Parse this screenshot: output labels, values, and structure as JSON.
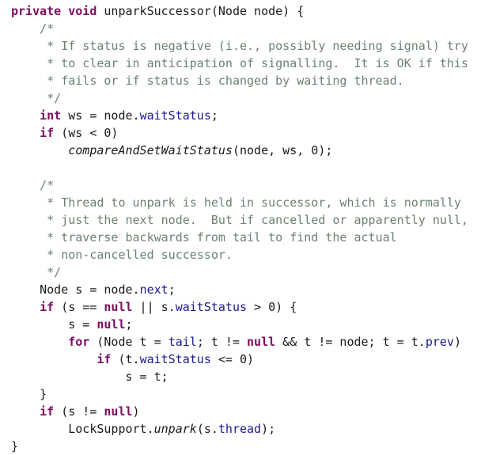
{
  "editor": {
    "language": "java",
    "background_color": "#ffffff",
    "font_size_px": 15,
    "line_height_px": 22,
    "colors": {
      "keyword": "#7a0e5e",
      "comment": "#6b8270",
      "field": "#1a1a8c",
      "method": "#1a1a1a",
      "plain": "#1a1a1a"
    }
  },
  "code": {
    "lines": [
      {
        "index": 1,
        "text": "private void unparkSuccessor(Node node) {",
        "tokens": [
          {
            "t": "private",
            "k": "kw"
          },
          {
            "t": " ",
            "k": "pln"
          },
          {
            "t": "void",
            "k": "kw"
          },
          {
            "t": " unparkSuccessor(Node node) {",
            "k": "pln"
          }
        ]
      },
      {
        "index": 2,
        "text": "    /*",
        "tokens": [
          {
            "t": "    ",
            "k": "pln"
          },
          {
            "t": "/*",
            "k": "cmt"
          }
        ]
      },
      {
        "index": 3,
        "text": "     * If status is negative (i.e., possibly needing signal) try",
        "tokens": [
          {
            "t": "     ",
            "k": "pln"
          },
          {
            "t": "* If status is negative (i.e., possibly needing signal) try",
            "k": "cmt"
          }
        ]
      },
      {
        "index": 4,
        "text": "     * to clear in anticipation of signalling.  It is OK if this",
        "tokens": [
          {
            "t": "     ",
            "k": "pln"
          },
          {
            "t": "* to clear in anticipation of signalling.  It is OK if this",
            "k": "cmt"
          }
        ]
      },
      {
        "index": 5,
        "text": "     * fails or if status is changed by waiting thread.",
        "tokens": [
          {
            "t": "     ",
            "k": "pln"
          },
          {
            "t": "* fails or if status is changed by waiting thread.",
            "k": "cmt"
          }
        ]
      },
      {
        "index": 6,
        "text": "     */",
        "tokens": [
          {
            "t": "     ",
            "k": "pln"
          },
          {
            "t": "*/",
            "k": "cmt"
          }
        ]
      },
      {
        "index": 7,
        "text": "    int ws = node.waitStatus;",
        "tokens": [
          {
            "t": "    ",
            "k": "pln"
          },
          {
            "t": "int",
            "k": "kw"
          },
          {
            "t": " ws = node.",
            "k": "pln"
          },
          {
            "t": "waitStatus",
            "k": "fld"
          },
          {
            "t": ";",
            "k": "pln"
          }
        ]
      },
      {
        "index": 8,
        "text": "    if (ws < 0)",
        "tokens": [
          {
            "t": "    ",
            "k": "pln"
          },
          {
            "t": "if",
            "k": "kw"
          },
          {
            "t": " (ws < 0)",
            "k": "pln"
          }
        ]
      },
      {
        "index": 9,
        "text": "        compareAndSetWaitStatus(node, ws, 0);",
        "tokens": [
          {
            "t": "        ",
            "k": "pln"
          },
          {
            "t": "compareAndSetWaitStatus",
            "k": "mth"
          },
          {
            "t": "(node, ws, 0);",
            "k": "pln"
          }
        ]
      },
      {
        "index": 10,
        "text": "",
        "tokens": []
      },
      {
        "index": 11,
        "text": "    /*",
        "tokens": [
          {
            "t": "    ",
            "k": "pln"
          },
          {
            "t": "/*",
            "k": "cmt"
          }
        ]
      },
      {
        "index": 12,
        "text": "     * Thread to unpark is held in successor, which is normally",
        "tokens": [
          {
            "t": "     ",
            "k": "pln"
          },
          {
            "t": "* Thread to unpark is held in successor, which is normally",
            "k": "cmt"
          }
        ]
      },
      {
        "index": 13,
        "text": "     * just the next node.  But if cancelled or apparently null,",
        "tokens": [
          {
            "t": "     ",
            "k": "pln"
          },
          {
            "t": "* just the next node.  But if cancelled or apparently null,",
            "k": "cmt"
          }
        ]
      },
      {
        "index": 14,
        "text": "     * traverse backwards from tail to find the actual",
        "tokens": [
          {
            "t": "     ",
            "k": "pln"
          },
          {
            "t": "* traverse backwards from tail to find the actual",
            "k": "cmt"
          }
        ]
      },
      {
        "index": 15,
        "text": "     * non-cancelled successor.",
        "tokens": [
          {
            "t": "     ",
            "k": "pln"
          },
          {
            "t": "* non-cancelled successor.",
            "k": "cmt"
          }
        ]
      },
      {
        "index": 16,
        "text": "     */",
        "tokens": [
          {
            "t": "     ",
            "k": "pln"
          },
          {
            "t": "*/",
            "k": "cmt"
          }
        ]
      },
      {
        "index": 17,
        "text": "    Node s = node.next;",
        "tokens": [
          {
            "t": "    Node s = node.",
            "k": "pln"
          },
          {
            "t": "next",
            "k": "fld"
          },
          {
            "t": ";",
            "k": "pln"
          }
        ]
      },
      {
        "index": 18,
        "text": "    if (s == null || s.waitStatus > 0) {",
        "tokens": [
          {
            "t": "    ",
            "k": "pln"
          },
          {
            "t": "if",
            "k": "kw"
          },
          {
            "t": " (s == ",
            "k": "pln"
          },
          {
            "t": "null",
            "k": "kw"
          },
          {
            "t": " || s.",
            "k": "pln"
          },
          {
            "t": "waitStatus",
            "k": "fld"
          },
          {
            "t": " > 0) {",
            "k": "pln"
          }
        ]
      },
      {
        "index": 19,
        "text": "        s = null;",
        "tokens": [
          {
            "t": "        s = ",
            "k": "pln"
          },
          {
            "t": "null",
            "k": "kw"
          },
          {
            "t": ";",
            "k": "pln"
          }
        ]
      },
      {
        "index": 20,
        "text": "        for (Node t = tail; t != null && t != node; t = t.prev)",
        "tokens": [
          {
            "t": "        ",
            "k": "pln"
          },
          {
            "t": "for",
            "k": "kw"
          },
          {
            "t": " (Node t = ",
            "k": "pln"
          },
          {
            "t": "tail",
            "k": "fld"
          },
          {
            "t": "; t != ",
            "k": "pln"
          },
          {
            "t": "null",
            "k": "kw"
          },
          {
            "t": " && t != node; t = t.",
            "k": "pln"
          },
          {
            "t": "prev",
            "k": "fld"
          },
          {
            "t": ")",
            "k": "pln"
          }
        ]
      },
      {
        "index": 21,
        "text": "            if (t.waitStatus <= 0)",
        "tokens": [
          {
            "t": "            ",
            "k": "pln"
          },
          {
            "t": "if",
            "k": "kw"
          },
          {
            "t": " (t.",
            "k": "pln"
          },
          {
            "t": "waitStatus",
            "k": "fld"
          },
          {
            "t": " <= 0)",
            "k": "pln"
          }
        ]
      },
      {
        "index": 22,
        "text": "                s = t;",
        "tokens": [
          {
            "t": "                s = t;",
            "k": "pln"
          }
        ]
      },
      {
        "index": 23,
        "text": "    }",
        "tokens": [
          {
            "t": "    }",
            "k": "pln"
          }
        ]
      },
      {
        "index": 24,
        "text": "    if (s != null)",
        "tokens": [
          {
            "t": "    ",
            "k": "pln"
          },
          {
            "t": "if",
            "k": "kw"
          },
          {
            "t": " (s != ",
            "k": "pln"
          },
          {
            "t": "null",
            "k": "kw"
          },
          {
            "t": ")",
            "k": "pln"
          }
        ]
      },
      {
        "index": 25,
        "text": "        LockSupport.unpark(s.thread);",
        "tokens": [
          {
            "t": "        LockSupport.",
            "k": "pln"
          },
          {
            "t": "unpark",
            "k": "mth"
          },
          {
            "t": "(s.",
            "k": "pln"
          },
          {
            "t": "thread",
            "k": "fld"
          },
          {
            "t": ");",
            "k": "pln"
          }
        ]
      },
      {
        "index": 26,
        "text": "}",
        "tokens": [
          {
            "t": "}",
            "k": "pln"
          }
        ]
      }
    ]
  }
}
